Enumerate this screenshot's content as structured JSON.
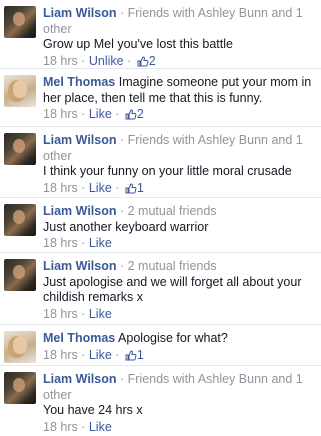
{
  "comments": [
    {
      "author": "Liam Wilson",
      "friend_info": " · Friends with Ashley Bunn and 1 other",
      "text": "Grow up Mel you've lost this battle",
      "time": "18 hrs",
      "action": "Unlike",
      "likes": "2"
    },
    {
      "author": "Mel Thomas",
      "friend_info": "",
      "text": "Imagine someone put your mom in her place, then tell me that this is funny.",
      "time": "18 hrs",
      "action": "Like",
      "likes": "2"
    },
    {
      "author": "Liam Wilson",
      "friend_info": " · Friends with Ashley Bunn and 1 other",
      "text": "I think your funny on your little moral crusade",
      "time": "18 hrs",
      "action": "Like",
      "likes": "1"
    },
    {
      "author": "Liam Wilson",
      "friend_info": " · 2 mutual friends",
      "text": "Just another keyboard warrior",
      "time": "18 hrs",
      "action": "Like",
      "likes": ""
    },
    {
      "author": "Liam Wilson",
      "friend_info": " · 2 mutual friends",
      "text": "Just apologise and we will forget all about your childish remarks x",
      "time": "18 hrs",
      "action": "Like",
      "likes": ""
    },
    {
      "author": "Mel Thomas",
      "friend_info": "",
      "text": "Apologise for what?",
      "time": "18 hrs",
      "action": "Like",
      "likes": "1"
    },
    {
      "author": "Liam Wilson",
      "friend_info": " · Friends with Ashley Bunn and 1 other",
      "text": "You have 24 hrs x",
      "time": "18 hrs",
      "action": "Like",
      "likes": ""
    }
  ],
  "separator": " · ",
  "icons": {
    "like": "thumbs-up-icon"
  },
  "colors": {
    "link": "#3b5998",
    "meta": "#90949c",
    "text": "#141823"
  }
}
